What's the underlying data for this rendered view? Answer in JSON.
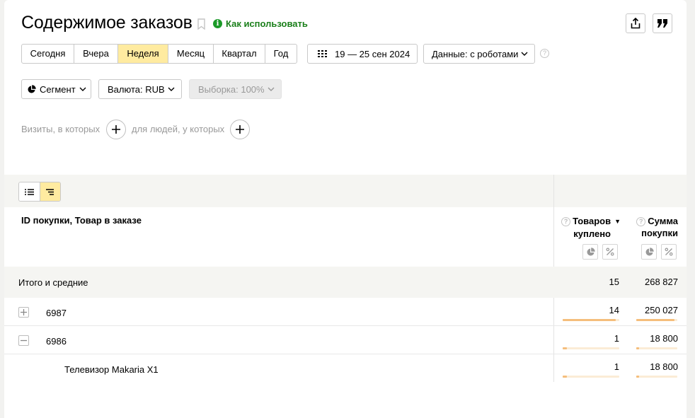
{
  "header": {
    "title": "Содержимое заказов",
    "howto_label": "Как использовать"
  },
  "period": {
    "items": [
      "Сегодня",
      "Вчера",
      "Неделя",
      "Месяц",
      "Квартал",
      "Год"
    ],
    "active": "Неделя",
    "date_range": "19 — 25 сен 2024"
  },
  "controls": {
    "data_label": "Данные: с роботами",
    "segment_label": "Сегмент",
    "currency_label": "Валюта: RUB",
    "sample_label": "Выборка: 100%"
  },
  "filters": {
    "visits_label": "Визиты, в которых",
    "people_label": "для людей, у которых"
  },
  "table": {
    "dimension_header": "ID покупки, Товар в заказе",
    "metrics": [
      {
        "line1": "Товаров",
        "line2": "куплено",
        "sort_icon": "sort-desc-icon"
      },
      {
        "line1": "Сумма",
        "line2": "покупки"
      }
    ],
    "total_label": "Итого и средние",
    "totals": [
      "15",
      "268 827"
    ],
    "rows": [
      {
        "id": "6987",
        "expand_state": "collapsed",
        "values": [
          "14",
          "250 027"
        ],
        "share": [
          0.933,
          0.93
        ]
      },
      {
        "id": "6986",
        "expand_state": "expanded",
        "values": [
          "1",
          "18 800"
        ],
        "share": [
          0.067,
          0.07
        ]
      },
      {
        "id": "Телевизор Makaria X1",
        "child": true,
        "values": [
          "1",
          "18 800"
        ],
        "share": [
          0.067,
          0.07
        ]
      }
    ]
  },
  "colors": {
    "accent": "#ffeba0",
    "howto": "#1a7f1a",
    "bar_fill": "#f5be7c",
    "bar_track": "#fbecd6"
  }
}
